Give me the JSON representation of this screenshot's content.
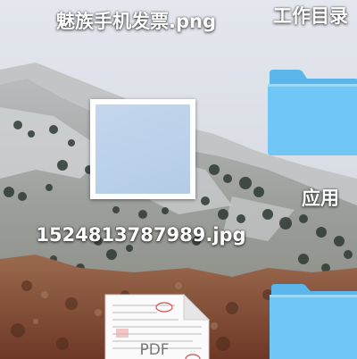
{
  "desktop": {
    "icons": {
      "invoice_png": {
        "label": "魅族手机发票.png"
      },
      "work_folder": {
        "label": "工作目录"
      },
      "apps_folder": {
        "label": "应用"
      },
      "image_jpg": {
        "label": "1524813787989.jpg"
      },
      "pdf_file": {
        "badge": "PDF"
      }
    }
  },
  "colors": {
    "folder_blue": "#6cc4f5",
    "folder_blue_light": "#8dd3f8",
    "folder_tab": "#5bb6ec"
  }
}
